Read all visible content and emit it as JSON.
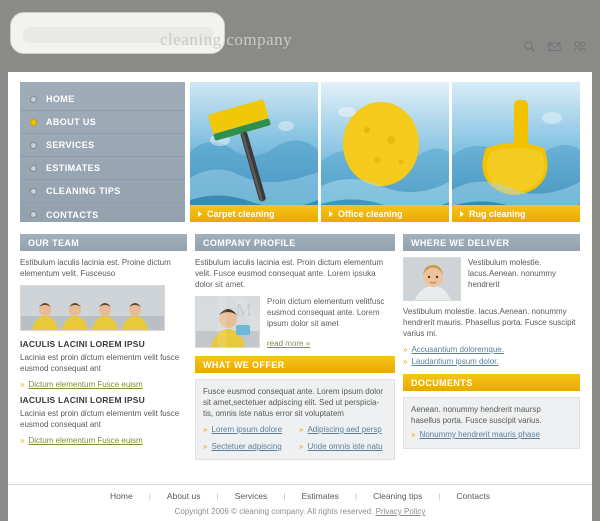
{
  "header": {
    "site_title": "cleaning company",
    "icons": [
      "search-icon",
      "mail-icon",
      "users-icon"
    ]
  },
  "nav": {
    "items": [
      {
        "label": "HOME",
        "active": false
      },
      {
        "label": "ABOUT US",
        "active": true
      },
      {
        "label": "SERVICES",
        "active": false
      },
      {
        "label": "ESTIMATES",
        "active": false
      },
      {
        "label": "CLEANING TIPS",
        "active": false
      },
      {
        "label": "CONTACTS",
        "active": false
      }
    ]
  },
  "hero": {
    "captions": [
      "Carpet cleaning",
      "Office cleaning",
      "Rug cleaning"
    ]
  },
  "col1": {
    "heading": "OUR TEAM",
    "intro": "Estibulum iaculis lacinia est. Proine dictum elementum velit. Fusceuso",
    "blocks": [
      {
        "title": "IACULIS LACINI LOREM IPSU",
        "text": "Lacinia est proin dictum elementm velit fusce eusmod consequat ant",
        "link": "Dictum elementum Fusce euism"
      },
      {
        "title": "IACULIS LACINI LOREM IPSU",
        "text": "Lacinia est proin dictum elementm velit fusce eusmod consequat ant",
        "link": "Dictum elementum Fusce euism"
      }
    ]
  },
  "col2": {
    "heading": "COMPANY PROFILE",
    "intro": "Estibulum iaculis lacinia est. Proin dictum elementum velit. Fusce eusmod consequat ante. Lorem ipsuka dolor sit amet.",
    "profile_text": "Proin dictum elementum velitfusc eusmod consequat ante. Lorem ipsum dolor sit amet",
    "read_more": "read more  »",
    "offer_heading": "WHAT WE OFFER",
    "offer_text": "Fusce eusmod consequat ante. Lorem ipsum dolor sit amet,sectetuer adpiscing elit. Sed ut perspicia- tis, omnis iste natus error sit voluptatem",
    "offer_links": [
      "Lorem ipsum dolore",
      "Adipiscing aed persp",
      "Sectetuer adpiscing",
      "Unde omnis iste natu"
    ]
  },
  "col3": {
    "heading": "WHERE WE DELIVER",
    "photo_text": "Vestibulum molestie. lacus.Aenean. nonummy hendrerit",
    "body": "Vestibulum molestie. lacus.Aenean. nonummy hendrerit mauris. Phasellus porta. Fusce suscipit varius mi.",
    "links": [
      "Accusantium doloremque.",
      "Laudantium ipsum dolor."
    ],
    "docs_heading": "DOCUMENTS",
    "docs_text": "Aenean. nonummy hendrerit maursp hasellus porta. Fusce suscipit varius.",
    "docs_link": "Nonummy hendrerit mauris phase"
  },
  "footer": {
    "links": [
      "Home",
      "About us",
      "Services",
      "Estimates",
      "Cleaning tips",
      "Contacts"
    ],
    "copyright_prefix": "Copyright 2006 © cleaning company. All rights reserved. ",
    "privacy": "Privacy Policy"
  },
  "colors": {
    "page_bg": "#8a8a89",
    "nav_blue": "#9aa8b5",
    "accent_yellow": "#f2b705",
    "link_green": "#7d8c3f",
    "link_blue": "#5b7f9e"
  },
  "watermark": {
    "text": "M"
  }
}
